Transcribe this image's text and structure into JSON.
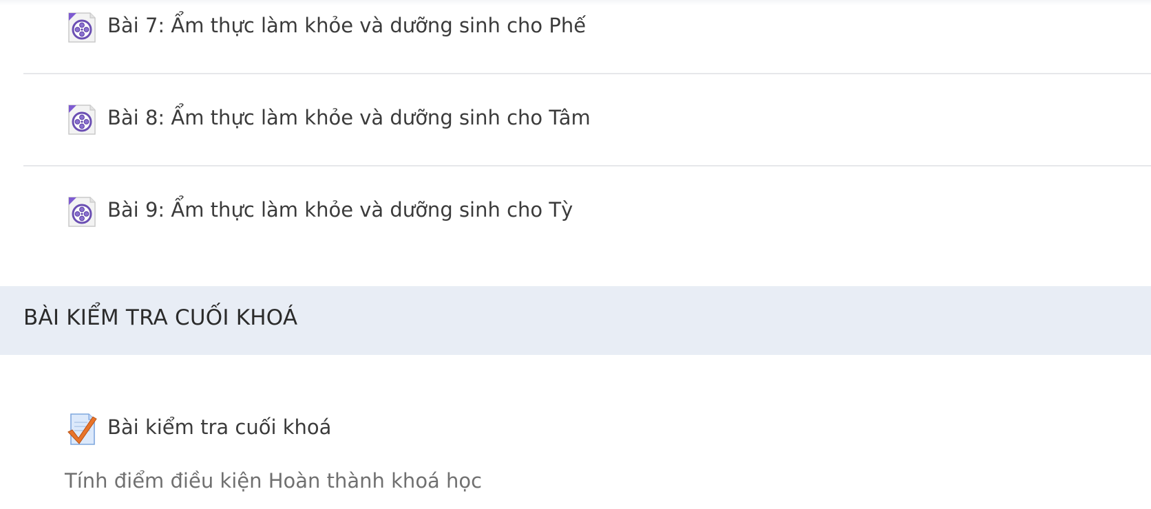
{
  "activities": [
    {
      "label": "Bài 7: Ẩm thực làm khỏe và dưỡng sinh cho Phế",
      "icon": "video-file-icon"
    },
    {
      "label": "Bài 8: Ẩm thực làm khỏe và dưỡng sinh cho Tâm",
      "icon": "video-file-icon"
    },
    {
      "label": "Bài 9: Ẩm thực làm khỏe và dưỡng sinh cho Tỳ",
      "icon": "video-file-icon"
    }
  ],
  "final_section": {
    "title": "BÀI KIỂM TRA CUỐI KHOÁ",
    "quiz": {
      "label": "Bài kiểm tra cuối khoá",
      "icon": "quiz-checkmark-icon",
      "description": "Tính điểm điều kiện Hoàn thành khoá học"
    }
  },
  "colors": {
    "section_header_bg": "#e8edf5",
    "divider": "#e6e7ea",
    "text": "#3b3b3b",
    "muted_text": "#707070",
    "icon_purple": "#6b4fb3",
    "check_orange": "#e8742a"
  }
}
